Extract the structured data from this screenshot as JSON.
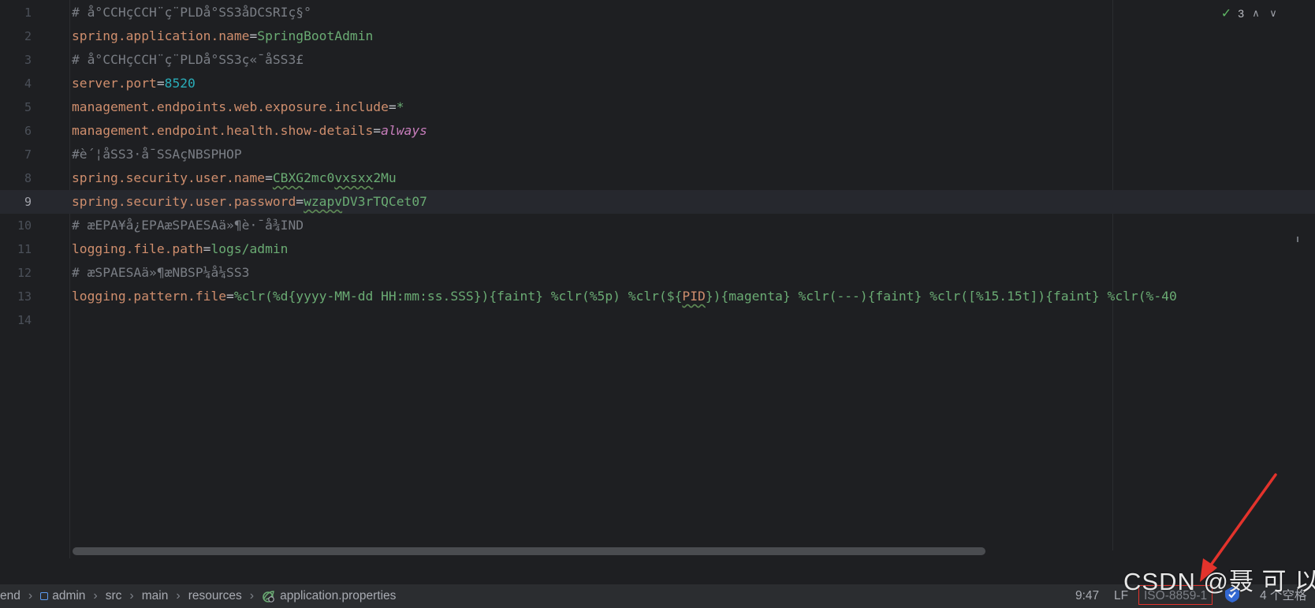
{
  "editor": {
    "lines": [
      {
        "num": "1",
        "tokens": [
          {
            "t": "# å°CCHçCCH¨ç¨PLDå°SS3åDCSRIç§°",
            "c": "cmt"
          }
        ]
      },
      {
        "num": "2",
        "tokens": [
          {
            "t": "spring.application.name",
            "c": "key"
          },
          {
            "t": "=",
            "c": "eq"
          },
          {
            "t": "SpringBootAdmin",
            "c": "val"
          }
        ]
      },
      {
        "num": "3",
        "tokens": [
          {
            "t": "# å°CCHçCCH¨ç¨PLDå°SS3ç«¯åSS3£",
            "c": "cmt"
          }
        ]
      },
      {
        "num": "4",
        "tokens": [
          {
            "t": "server.port",
            "c": "key"
          },
          {
            "t": "=",
            "c": "eq"
          },
          {
            "t": "8520",
            "c": "num"
          }
        ]
      },
      {
        "num": "5",
        "tokens": [
          {
            "t": "management.endpoints.web.exposure.include",
            "c": "key"
          },
          {
            "t": "=",
            "c": "eq"
          },
          {
            "t": "*",
            "c": "val"
          }
        ]
      },
      {
        "num": "6",
        "tokens": [
          {
            "t": "management.endpoint.health.show-details",
            "c": "key"
          },
          {
            "t": "=",
            "c": "eq"
          },
          {
            "t": "always",
            "c": "ital"
          }
        ]
      },
      {
        "num": "7",
        "tokens": [
          {
            "t": "#è´¦åSS3·å¯SSAçNBSPHOP",
            "c": "cmt"
          }
        ]
      },
      {
        "num": "8",
        "tokens": [
          {
            "t": "spring.security.user.name",
            "c": "key"
          },
          {
            "t": "=",
            "c": "eq"
          },
          {
            "t": "CBXG",
            "c": "val squig"
          },
          {
            "t": "2mc0",
            "c": "val"
          },
          {
            "t": "vxsxx",
            "c": "val squig"
          },
          {
            "t": "2Mu",
            "c": "val"
          }
        ]
      },
      {
        "num": "9",
        "tokens": [
          {
            "t": "spring.security.user.password",
            "c": "key"
          },
          {
            "t": "=",
            "c": "eq"
          },
          {
            "t": "wzapv",
            "c": "val squig"
          },
          {
            "t": "DV3rTQCet07",
            "c": "val"
          }
        ],
        "current": true
      },
      {
        "num": "10",
        "tokens": [
          {
            "t": "# æEPA¥å¿EPAæSPAESAä»¶è·¯å¾IND",
            "c": "cmt"
          }
        ]
      },
      {
        "num": "11",
        "tokens": [
          {
            "t": "logging.file.path",
            "c": "key"
          },
          {
            "t": "=",
            "c": "eq"
          },
          {
            "t": "logs/admin",
            "c": "val"
          }
        ]
      },
      {
        "num": "12",
        "tokens": [
          {
            "t": "# æSPAESAä»¶æNBSP¼å¼SS3",
            "c": "cmt"
          }
        ]
      },
      {
        "num": "13",
        "tokens": [
          {
            "t": "logging.pattern.file",
            "c": "key"
          },
          {
            "t": "=",
            "c": "eq"
          },
          {
            "t": "%clr(%d{yyyy-MM-dd HH:mm:ss.SSS}){faint} %clr(%5p) %clr(${",
            "c": "val"
          },
          {
            "t": "PID",
            "c": "key squig"
          },
          {
            "t": "}){magenta} %clr(---){faint} %clr([%15.15t]){faint} %clr(%-40",
            "c": "val"
          }
        ]
      },
      {
        "num": "14",
        "tokens": []
      }
    ],
    "inspection_count": "3"
  },
  "statusbar": {
    "breadcrumbs": [
      "end",
      "admin",
      "src",
      "main",
      "resources",
      "application.properties"
    ],
    "caret_position": "9:47",
    "line_separator": "LF",
    "encoding": "ISO-8859-1",
    "indent": "4 个空格"
  },
  "watermark": "CSDN @聂 可 以",
  "colors": {
    "highlight_box": "#e3332c",
    "arrow": "#e3332c"
  }
}
